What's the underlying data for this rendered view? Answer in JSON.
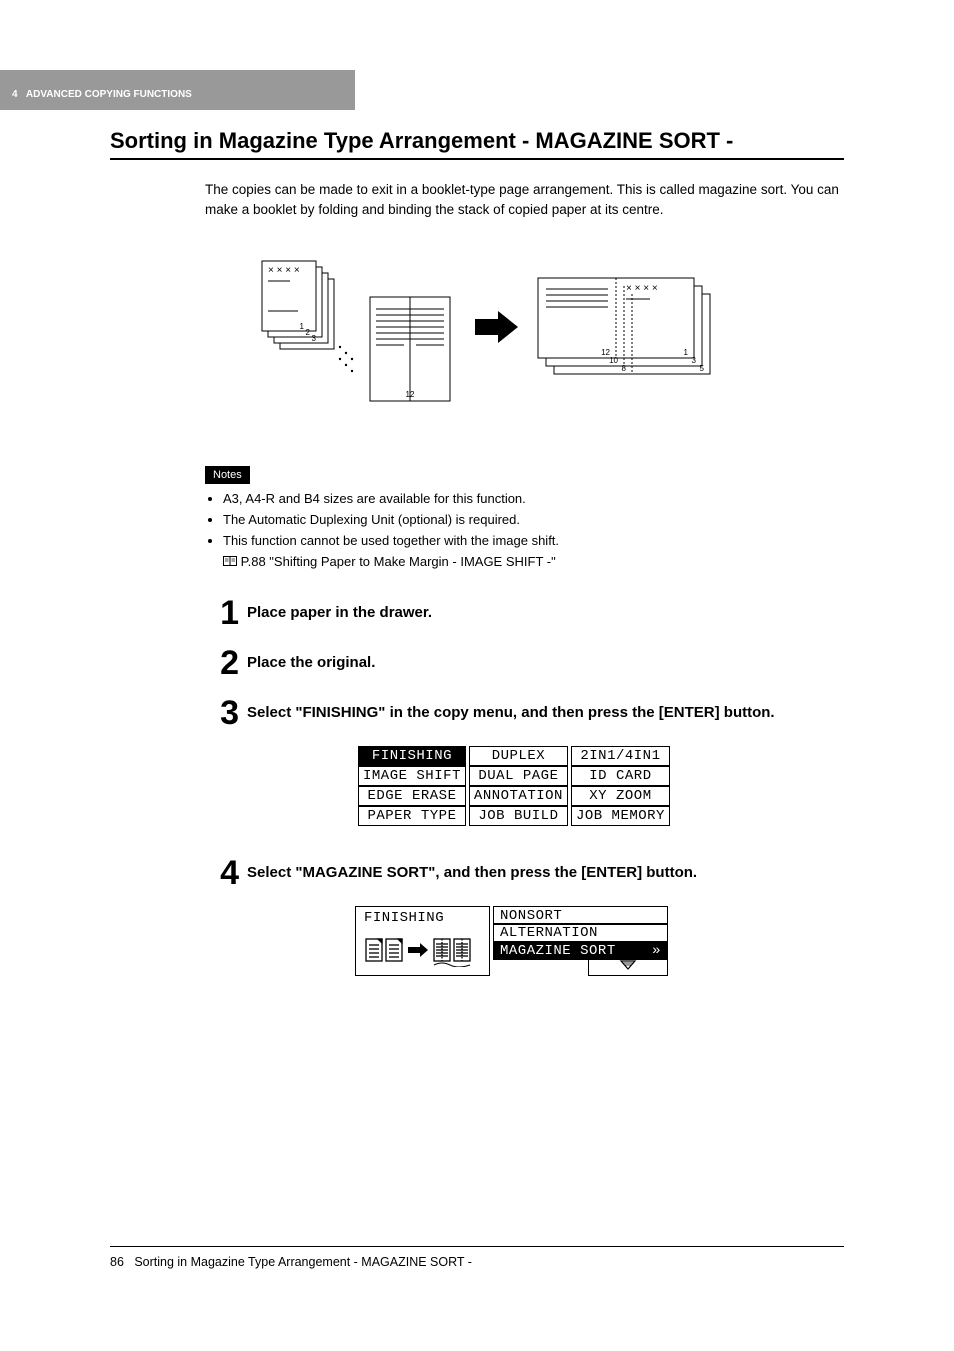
{
  "header": {
    "chapter_num": "4",
    "chapter_title": "ADVANCED COPYING FUNCTIONS"
  },
  "section_title": "Sorting in Magazine Type Arrangement - MAGAZINE SORT -",
  "intro": "The copies can be made to exit in a booklet-type page arrangement. This is called magazine sort. You can make a booklet by folding and binding the stack of copied paper at its centre.",
  "diagram": {
    "left_stack": {
      "n1": "1",
      "n2": "2",
      "n3": "3"
    },
    "middle_booklet": {
      "label": "12"
    },
    "right_stack": {
      "p12": "12",
      "p1": "1",
      "p10": "10",
      "p3": "3",
      "p8": "8",
      "p5": "5"
    }
  },
  "notes_label": "Notes",
  "notes": [
    "A3, A4-R and B4 sizes are available for this function.",
    "The Automatic Duplexing Unit (optional) is required.",
    "This function cannot be used together with the image shift."
  ],
  "xref": "P.88 \"Shifting Paper to Make Margin - IMAGE SHIFT -\"",
  "steps": {
    "s1": {
      "num": "1",
      "text": "Place paper in the drawer."
    },
    "s2": {
      "num": "2",
      "text": "Place the original."
    },
    "s3": {
      "num": "3",
      "text": "Select \"FINISHING\" in the copy menu, and then press the [ENTER] button."
    },
    "s4": {
      "num": "4",
      "text": "Select \"MAGAZINE SORT\", and then press the [ENTER] button."
    }
  },
  "menu": {
    "r1c1": "FINISHING",
    "r1c2": "DUPLEX",
    "r1c3": "2IN1/4IN1",
    "r2c1": "IMAGE SHIFT",
    "r2c2": "DUAL PAGE",
    "r2c3": "ID CARD",
    "r3c1": "EDGE ERASE",
    "r3c2": "ANNOTATION",
    "r3c3": "XY ZOOM",
    "r4c1": "PAPER TYPE",
    "r4c2": "JOB BUILD",
    "r4c3": "JOB MEMORY"
  },
  "finishing_panel": {
    "left_label": "FINISHING",
    "opt1": "NONSORT",
    "opt2": "ALTERNATION",
    "opt3": "MAGAZINE SORT",
    "opt3_arrow": "»"
  },
  "footer": {
    "page": "86",
    "title": "Sorting in Magazine Type Arrangement - MAGAZINE SORT -"
  }
}
